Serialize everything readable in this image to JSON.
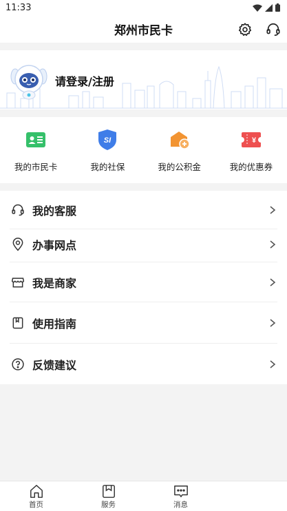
{
  "status_bar": {
    "time": "11:33"
  },
  "header": {
    "title": "郑州市民卡"
  },
  "profile": {
    "login_label": "请登录/注册"
  },
  "quick_actions": [
    {
      "label": "我的市民卡",
      "icon": "id-card-icon",
      "color": "#35c06a"
    },
    {
      "label": "我的社保",
      "icon": "social-security-shield-icon",
      "color": "#3f7de8",
      "glyph": "SI"
    },
    {
      "label": "我的公积金",
      "icon": "housing-fund-icon",
      "color": "#f29432"
    },
    {
      "label": "我的优惠券",
      "icon": "coupon-icon",
      "color": "#ee5050",
      "glyph": "¥"
    }
  ],
  "menu": [
    {
      "label": "我的客服",
      "icon": "headset-icon"
    },
    {
      "label": "办事网点",
      "icon": "location-pin-icon"
    },
    {
      "label": "我是商家",
      "icon": "shop-icon"
    },
    {
      "label": "使用指南",
      "icon": "guide-book-icon"
    },
    {
      "label": "反馈建议",
      "icon": "question-icon"
    }
  ],
  "tabbar": [
    {
      "label": "首页",
      "icon": "home-icon"
    },
    {
      "label": "服务",
      "icon": "bookmark-icon"
    },
    {
      "label": "消息",
      "icon": "message-icon"
    }
  ]
}
